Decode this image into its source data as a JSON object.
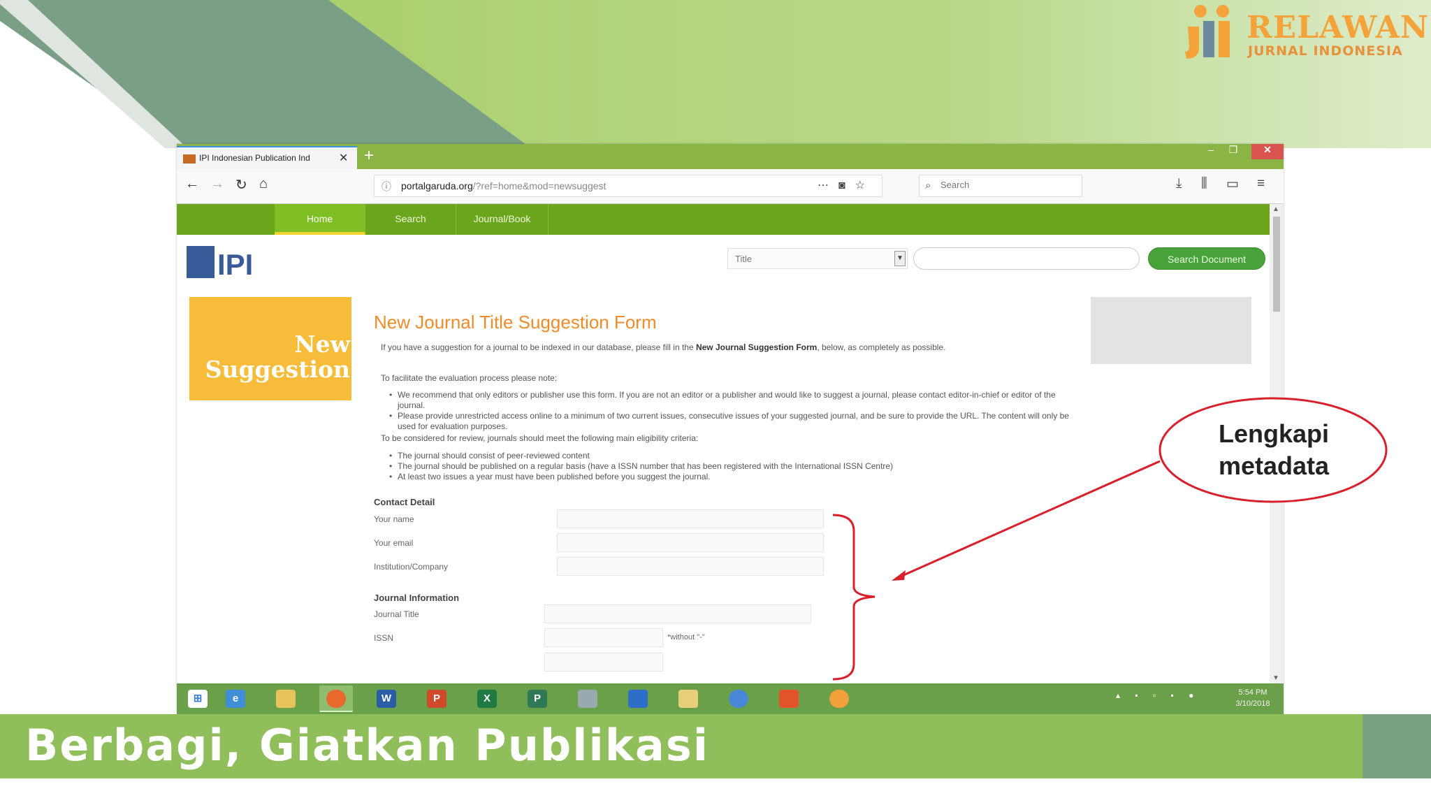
{
  "slide": {
    "brand_line1": "RELAWAN",
    "brand_line2": "JURNAL INDONESIA",
    "banner_text": "Berbagi, Giatkan Publikasi",
    "callout_line1": "Lengkapi",
    "callout_line2": "metadata",
    "colors": {
      "accent_green": "#8fbe5b",
      "callout_red": "#d9202a",
      "orange": "#f08b2a"
    }
  },
  "browser": {
    "tab_title": "IPI Indonesian Publication Ind",
    "new_tab": "+",
    "url_domain": "portalgaruda.org",
    "url_path": "/?ref=home&mod=newsuggest",
    "search_placeholder": "Search",
    "window_controls": [
      "–",
      "❐",
      "✕"
    ]
  },
  "site": {
    "nav": [
      "Home",
      "Search",
      "Journal/Book"
    ],
    "logo_text": "IPI",
    "filter_value": "Title",
    "search_button": "Search Document",
    "side_banner_line1": "New",
    "side_banner_line2": "Suggestion"
  },
  "form": {
    "title": "New Journal Title Suggestion Form",
    "intro_a": "If you have a suggestion for a journal to be indexed in our database, please fill in the ",
    "intro_bold": "New Journal Suggestion Form",
    "intro_b": ", below, as completely as possible.",
    "note_heading": "To facilitate the evaluation process please note:",
    "notes": [
      "We recommend that only editors or publisher use this form. If you are not an editor or a publisher and would like to suggest a journal, please contact editor-in-chief or editor of the journal.",
      "Please provide unrestricted access online to a minimum of two current issues, consecutive issues of your suggested journal, and be sure to provide the URL. The content will only be used for evaluation purposes."
    ],
    "criteria_heading": "To be considered for review, journals should meet the following main eligibility criteria:",
    "criteria": [
      "The journal should consist of peer-reviewed content",
      "The journal should be published on a regular basis (have a ISSN number that has been registered with the International ISSN Centre)",
      "At least two issues a year must have been published before you suggest the journal."
    ],
    "contact_heading": "Contact Detail",
    "your_name_label": "Your name",
    "your_email_label": "Your email",
    "institution_label": "Institution/Company",
    "journal_heading": "Journal Information",
    "journal_title_label": "Journal Title",
    "issn_label": "ISSN",
    "issn_hint": "*without \"-\"",
    "values": {
      "name": "",
      "email": "",
      "institution": "",
      "journal_title": "",
      "issn": ""
    }
  },
  "taskbar": {
    "apps": [
      "windows-start",
      "internet-explorer",
      "file-explorer",
      "firefox",
      "word",
      "powerpoint",
      "excel",
      "project",
      "paint",
      "scanner",
      "folder",
      "chrome",
      "foxit",
      "media"
    ],
    "clock_time": "5:54 PM",
    "clock_date": "3/10/2018"
  }
}
